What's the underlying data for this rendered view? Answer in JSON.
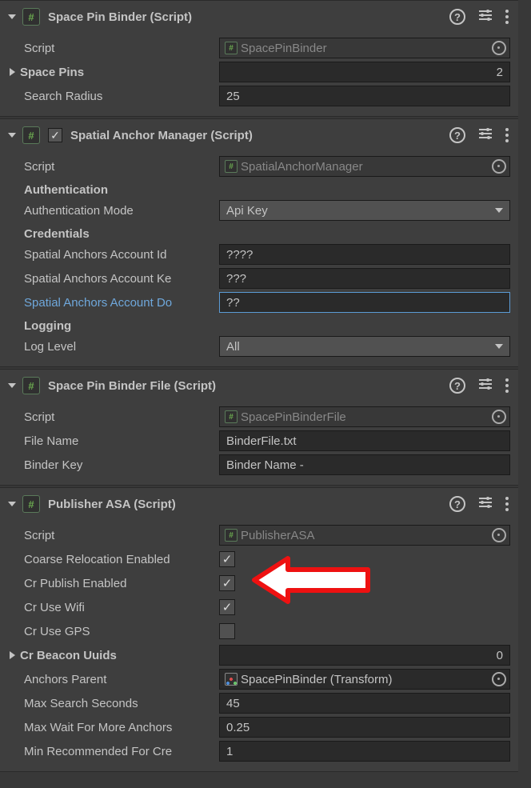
{
  "comp1": {
    "title": "Space Pin Binder (Script)",
    "script_label": "Script",
    "script_value": "SpacePinBinder",
    "space_pins_label": "Space Pins",
    "space_pins_value": "2",
    "search_radius_label": "Search Radius",
    "search_radius_value": "25"
  },
  "comp2": {
    "title": "Spatial Anchor Manager (Script)",
    "script_label": "Script",
    "script_value": "SpatialAnchorManager",
    "auth_header": "Authentication",
    "auth_mode_label": "Authentication Mode",
    "auth_mode_value": "Api Key",
    "cred_header": "Credentials",
    "acct_id_label": "Spatial Anchors Account Id",
    "acct_id_value": "????",
    "acct_key_label": "Spatial Anchors Account Ke",
    "acct_key_value": "???",
    "acct_dom_label": "Spatial Anchors Account Do",
    "acct_dom_value": "??",
    "log_header": "Logging",
    "log_level_label": "Log Level",
    "log_level_value": "All"
  },
  "comp3": {
    "title": "Space Pin Binder File (Script)",
    "script_label": "Script",
    "script_value": "SpacePinBinderFile",
    "file_name_label": "File Name",
    "file_name_value": "BinderFile.txt",
    "binder_key_label": "Binder Key",
    "binder_key_value": "Binder Name -"
  },
  "comp4": {
    "title": "Publisher ASA (Script)",
    "script_label": "Script",
    "script_value": "PublisherASA",
    "coarse_reloc_label": "Coarse Relocation Enabled",
    "cr_publish_label": "Cr Publish Enabled",
    "cr_wifi_label": "Cr Use Wifi",
    "cr_gps_label": "Cr Use GPS",
    "cr_beacon_label": "Cr Beacon Uuids",
    "cr_beacon_value": "0",
    "anchors_parent_label": "Anchors Parent",
    "anchors_parent_value": "SpacePinBinder (Transform)",
    "max_search_label": "Max Search Seconds",
    "max_search_value": "45",
    "max_wait_label": "Max Wait For More Anchors",
    "max_wait_value": "0.25",
    "min_rec_label": "Min Recommended For Cre",
    "min_rec_value": "1"
  }
}
